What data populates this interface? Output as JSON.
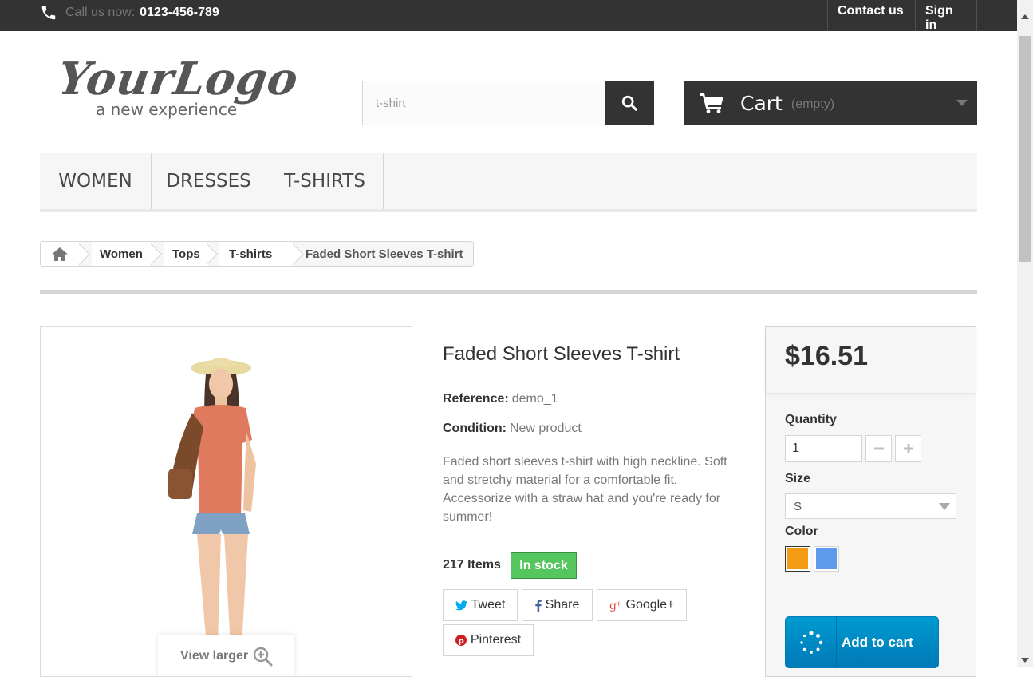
{
  "topbar": {
    "call_label": "Call us now:",
    "phone": "0123-456-789",
    "contact": "Contact us",
    "signin": "Sign in"
  },
  "logo": {
    "main": "YourLogo",
    "tagline": "a new experience"
  },
  "search": {
    "value": "t-shirt"
  },
  "cart": {
    "label": "Cart",
    "status": "(empty)"
  },
  "menu": {
    "items": [
      "WOMEN",
      "DRESSES",
      "T-SHIRTS"
    ]
  },
  "breadcrumb": {
    "items": [
      "Women",
      "Tops",
      "T-shirts",
      "Faded Short Sleeves T-shirt"
    ]
  },
  "product": {
    "title": "Faded Short Sleeves T-shirt",
    "reference_label": "Reference:",
    "reference": "demo_1",
    "condition_label": "Condition:",
    "condition": "New product",
    "description": "Faded short sleeves t-shirt with high neckline. Soft and stretchy material for a comfortable fit. Accessorize with a straw hat and you're ready for summer!",
    "items_count": "217 Items",
    "stock": "In stock",
    "view_larger": "View larger"
  },
  "social": {
    "tweet": "Tweet",
    "share": "Share",
    "google": "Google+",
    "pinterest": "Pinterest"
  },
  "buy": {
    "price": "$16.51",
    "quantity_label": "Quantity",
    "quantity": "1",
    "size_label": "Size",
    "size": "S",
    "color_label": "Color",
    "colors": [
      "#f39c11",
      "#5d9cec"
    ],
    "add_to_cart": "Add to cart"
  },
  "colors": {
    "dark": "#333333",
    "stock_green": "#55c65e",
    "cart_blue": "#009ad0"
  }
}
